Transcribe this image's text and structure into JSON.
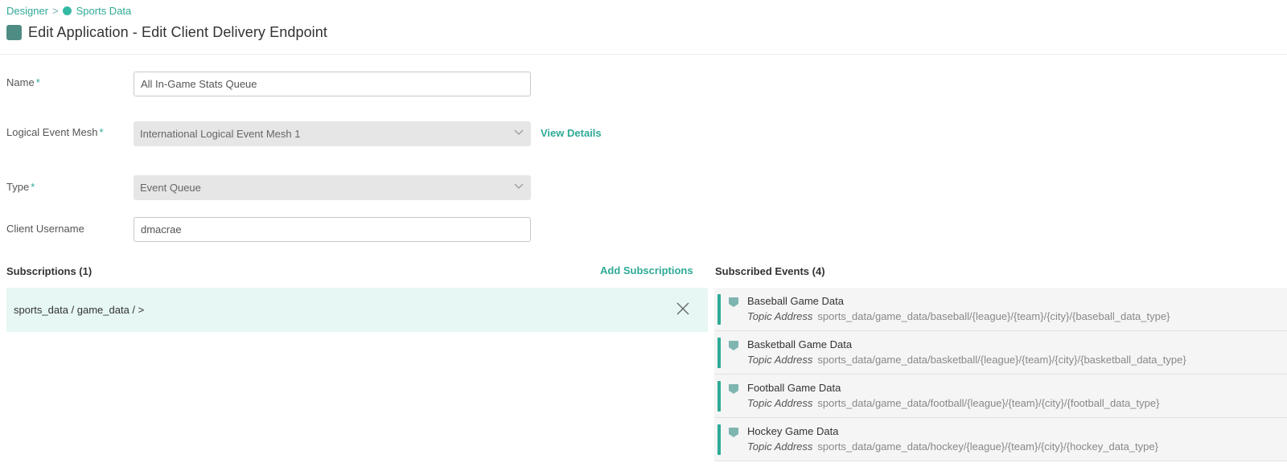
{
  "breadcrumb": {
    "root": "Designer",
    "separator": ">",
    "current": "Sports Data"
  },
  "page_title": "Edit Application - Edit Client Delivery Endpoint",
  "form": {
    "name_label": "Name",
    "name_value": "All In-Game Stats Queue",
    "mesh_label": "Logical Event Mesh",
    "mesh_value": "International Logical Event Mesh 1",
    "view_details": "View Details",
    "type_label": "Type",
    "type_value": "Event Queue",
    "username_label": "Client Username",
    "username_value": "dmacrae",
    "required_mark": "*"
  },
  "subscriptions": {
    "title": "Subscriptions (1)",
    "add_label": "Add Subscriptions",
    "items": [
      "sports_data / game_data / >"
    ]
  },
  "subscribed_events": {
    "title": "Subscribed Events (4)",
    "topic_label": "Topic Address",
    "items": [
      {
        "name": "Baseball Game Data",
        "topic": "sports_data/game_data/baseball/{league}/{team}/{city}/{baseball_data_type}"
      },
      {
        "name": "Basketball Game Data",
        "topic": "sports_data/game_data/basketball/{league}/{team}/{city}/{basketball_data_type}"
      },
      {
        "name": "Football Game Data",
        "topic": "sports_data/game_data/football/{league}/{team}/{city}/{football_data_type}"
      },
      {
        "name": "Hockey Game Data",
        "topic": "sports_data/game_data/hockey/{league}/{team}/{city}/{hockey_data_type}"
      }
    ]
  },
  "icons": {
    "app": "application-icon",
    "domain": "domain-dot-icon",
    "event": "event-icon",
    "remove": "close-icon",
    "dropdown": "chevron-down-icon"
  },
  "colors": {
    "accent": "#2eaa96",
    "selected_row": "#e6f7f4",
    "app_icon": "#4f8c84"
  }
}
